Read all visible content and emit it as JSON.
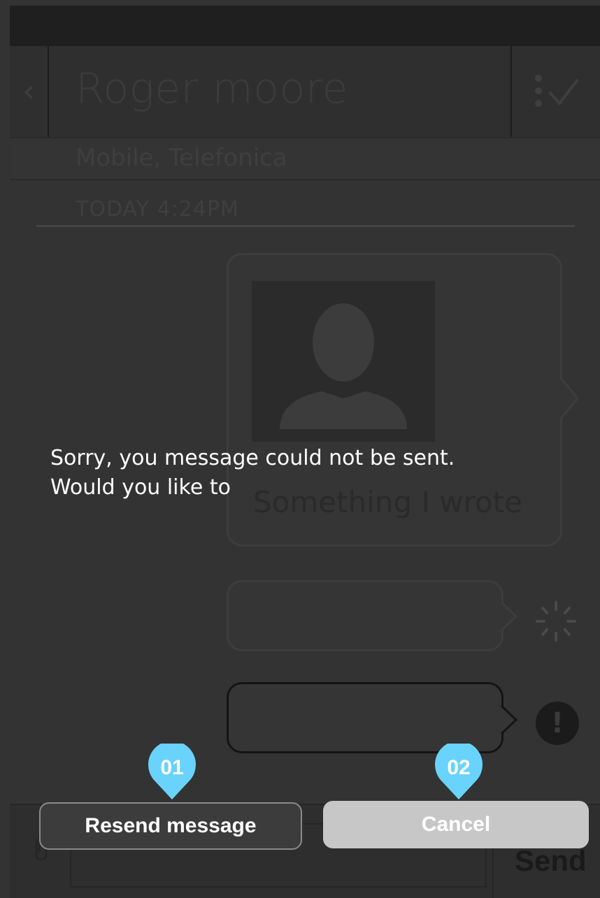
{
  "header": {
    "back_label": "‹",
    "title": "Roger moore",
    "edit_icon": "select-check-icon"
  },
  "subheader": {
    "carrier": "Mobile, Telefonica"
  },
  "thread": {
    "date": "TODAY 4:24PM",
    "message_text": "Something I wrote"
  },
  "compose": {
    "attach_icon": "paperclip-icon",
    "send_label": "Send"
  },
  "dialog": {
    "line1": "Sorry, you message could not be sent.",
    "line2": "Would you like to",
    "resend_label": "Resend message",
    "cancel_label": "Cancel"
  },
  "annotations": {
    "pin1": "01",
    "pin2": "02",
    "color": "#6ad3fb"
  }
}
